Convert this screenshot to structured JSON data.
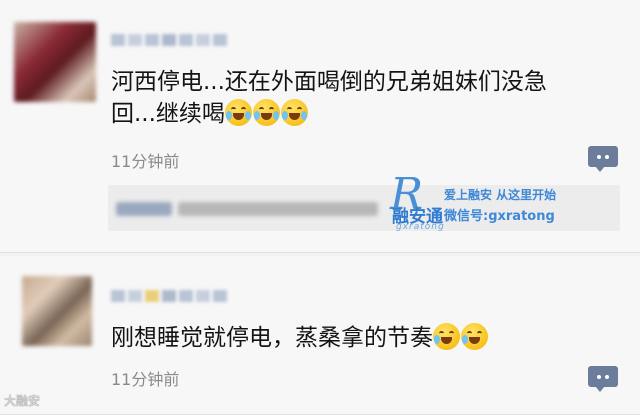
{
  "comments": [
    {
      "text_line1": "河西停电...还在外面喝倒的兄弟姐妹们没急",
      "text_line2": "回...继续喝",
      "emoji_icon": "laugh-cry-emoji",
      "emoji_count": 3,
      "time": "11分钟前"
    },
    {
      "text_line1": "刚想睡觉就停电，蒸桑拿的节奏",
      "emoji_icon": "grin-sweat-emoji",
      "emoji_count": 2,
      "time": "11分钟前"
    }
  ],
  "watermark": {
    "name": "融安通",
    "sub": "gxratong",
    "slogan": "爱上融安  从这里开始",
    "wechat": "微信号:gxratong"
  },
  "bottom_mark": "大融安",
  "colors": {
    "reply_button": "#6b7d9a",
    "watermark_blue": "#3f88d8",
    "timestamp": "#8a8a8a"
  }
}
